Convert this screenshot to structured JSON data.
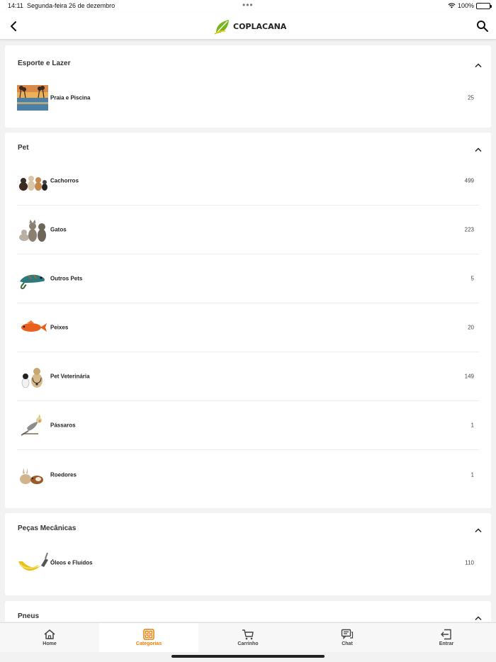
{
  "status_bar": {
    "time": "14:11",
    "date": "Segunda-feira 26 de dezembro",
    "dots": "•••",
    "battery": "100%"
  },
  "header": {
    "logo_text": "COPLACANA"
  },
  "sections": [
    {
      "title": "Esporte e Lazer",
      "items": [
        {
          "label": "Praia e Piscina",
          "count": "25",
          "icon": "pool-image"
        }
      ]
    },
    {
      "title": "Pet",
      "items": [
        {
          "label": "Cachorros",
          "count": "499",
          "icon": "dogs-image"
        },
        {
          "label": "Gatos",
          "count": "223",
          "icon": "cats-image"
        },
        {
          "label": "Outros Pets",
          "count": "5",
          "icon": "chameleon-image"
        },
        {
          "label": "Peixes",
          "count": "20",
          "icon": "fish-image"
        },
        {
          "label": "Pet Veterinária",
          "count": "149",
          "icon": "vet-image"
        },
        {
          "label": "Pássaros",
          "count": "1",
          "icon": "bird-image"
        },
        {
          "label": "Roedores",
          "count": "1",
          "icon": "rodents-image"
        }
      ]
    },
    {
      "title": "Peças Mecânicas",
      "items": [
        {
          "label": "Óleos e Fluidos",
          "count": "110",
          "icon": "oil-image"
        }
      ]
    },
    {
      "title": "Pneus",
      "items": []
    }
  ],
  "tabs": [
    {
      "label": "Home",
      "icon": "home-icon",
      "active": false
    },
    {
      "label": "Categorias",
      "icon": "categories-icon",
      "active": true
    },
    {
      "label": "Carrinho",
      "icon": "cart-icon",
      "active": false
    },
    {
      "label": "Chat",
      "icon": "chat-icon",
      "active": false
    },
    {
      "label": "Entrar",
      "icon": "login-icon",
      "active": false
    }
  ],
  "colors": {
    "accent": "#ee7d00",
    "logo_green": "#7ab51d"
  }
}
